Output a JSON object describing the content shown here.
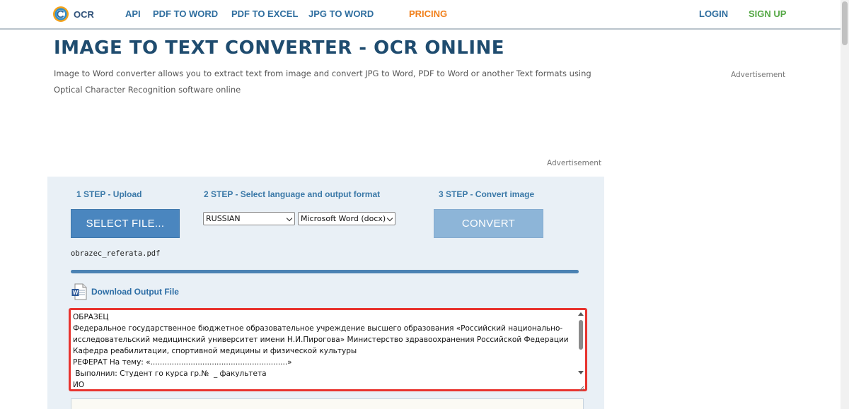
{
  "nav": {
    "logo_text": "OCR",
    "links": [
      "API",
      "PDF TO WORD",
      "PDF TO EXCEL",
      "JPG TO WORD"
    ],
    "pricing": "PRICING",
    "login": "LOGIN",
    "signup": "SIGN UP"
  },
  "header": {
    "title": "IMAGE TO TEXT CONVERTER - OCR ONLINE",
    "description": "Image to Word converter allows you to extract text from image and convert JPG to Word, PDF to Word or another Text formats using Optical Character Recognition software online"
  },
  "ads": {
    "right_label": "Advertisement",
    "middle_label": "Advertisement"
  },
  "converter": {
    "step1_label": "1 STEP - Upload",
    "step2_label": "2 STEP - Select language and output format",
    "step3_label": "3 STEP - Convert image",
    "select_file_button": "SELECT FILE...",
    "convert_button": "CONVERT",
    "language_selected": "RUSSIAN",
    "format_selected": "Microsoft Word (docx)",
    "file_name": "obrazec_referata.pdf",
    "progress": 1.0,
    "download_label": "Download Output File",
    "result_text": "ОБРАЗЕЦ\nФедеральное государственное бюджетное образовательное учреждение высшего образования «Российский национально-исследовательский медицинский университет имени Н.И.Пирогова» Министерство здравоохранения Российской Федерации Кафедра реабилитации, спортивной медицины и физической культуры\nРЕФЕРАТ На тему: «..........................................................»\n Выполнил: Студент го курса гр.№  _ факультета\nИО"
  },
  "colors": {
    "accent_blue": "#2f6e9f",
    "pricing_orange": "#f07f1a",
    "signup_green": "#55a845",
    "title_navy": "#1f4c6f",
    "highlight_red": "#e8342f"
  }
}
